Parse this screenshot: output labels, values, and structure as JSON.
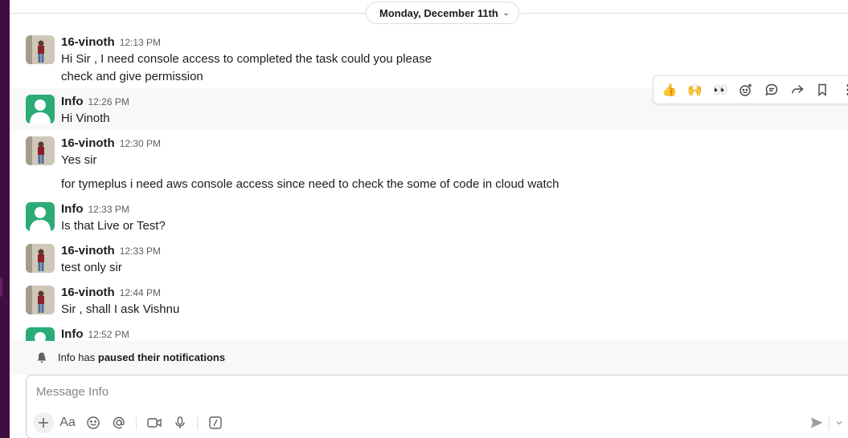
{
  "date_divider": {
    "label": "Monday, December 11th"
  },
  "messages": [
    {
      "author": "16-vinoth",
      "time": "12:13 PM",
      "lines": [
        "Hi Sir , I need console access to completed the task could you please",
        "check and give permission"
      ]
    },
    {
      "author": "Info",
      "time": "12:26 PM",
      "lines": [
        "Hi Vinoth"
      ]
    },
    {
      "author": "16-vinoth",
      "time": "12:30 PM",
      "lines": [
        "Yes sir"
      ]
    },
    {
      "lines": [
        "for tymeplus i need aws console access since need to check the some of code in cloud watch"
      ]
    },
    {
      "author": "Info",
      "time": "12:33 PM",
      "lines": [
        "Is that Live or Test?"
      ]
    },
    {
      "author": "16-vinoth",
      "time": "12:33 PM",
      "lines": [
        "test only sir"
      ]
    },
    {
      "author": "16-vinoth",
      "time": "12:44 PM",
      "lines": [
        "Sir , shall I ask Vishnu"
      ]
    },
    {
      "author": "Info",
      "time": "12:52 PM",
      "lines": []
    }
  ],
  "toolbar": {
    "reactions": [
      "👍",
      "🙌",
      "👀"
    ]
  },
  "banner": {
    "prefix": "Info has ",
    "bold": "paused their notifications"
  },
  "composer": {
    "placeholder": "Message Info",
    "format_label": "Aa"
  },
  "colors": {
    "sidebar": "#3f0e40",
    "info_avatar": "#2bac76",
    "hover_bg": "#f8f8f8"
  }
}
